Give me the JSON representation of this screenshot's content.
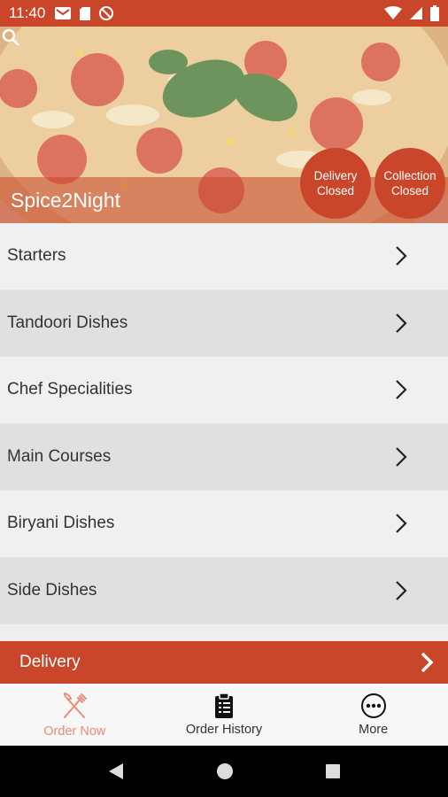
{
  "status_bar": {
    "time": "11:40",
    "left_icons": [
      "gmail-icon",
      "sim-card-icon",
      "do-not-disturb-icon"
    ],
    "right_icons": [
      "wifi-icon",
      "signal-icon",
      "battery-icon"
    ]
  },
  "hero": {
    "restaurant_name": "Spice2Night",
    "delivery_badge": {
      "line1": "Delivery",
      "line2": "Closed"
    },
    "collection_badge": {
      "line1": "Collection",
      "line2": "Closed"
    },
    "search_icon": "search-icon"
  },
  "menu": {
    "items": [
      {
        "label": "Starters"
      },
      {
        "label": "Tandoori Dishes"
      },
      {
        "label": "Chef Specialities"
      },
      {
        "label": "Main Courses"
      },
      {
        "label": "Biryani Dishes"
      },
      {
        "label": "Side Dishes"
      }
    ]
  },
  "delivery_bar": {
    "label": "Delivery"
  },
  "bottom_nav": {
    "items": [
      {
        "label": "Order Now",
        "icon": "fork-knife-icon",
        "active": true
      },
      {
        "label": "Order History",
        "icon": "clipboard-icon",
        "active": false
      },
      {
        "label": "More",
        "icon": "more-icon",
        "active": false
      }
    ]
  },
  "colors": {
    "brand": "#c9462a",
    "active_nav": "#e98d76"
  }
}
